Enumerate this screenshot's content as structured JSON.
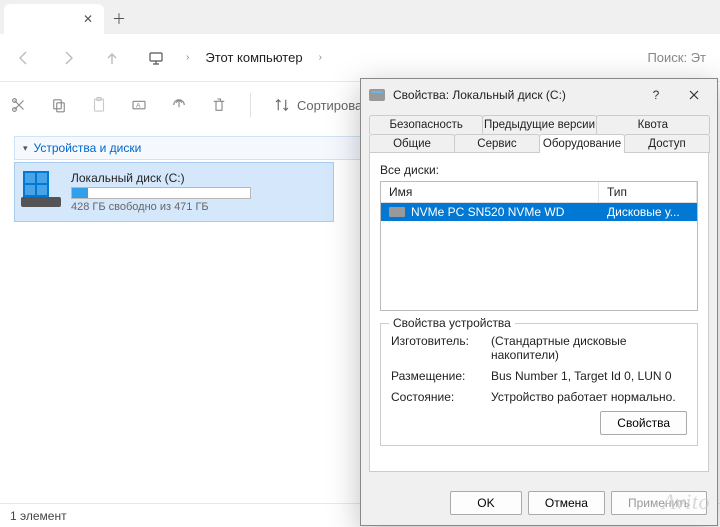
{
  "tabstrip": {
    "close_glyph": "✕",
    "newtab_glyph": "＋"
  },
  "addressbar": {
    "crumb": "Этот компьютер",
    "chevron": "›",
    "search_placeholder": "Поиск: Эт"
  },
  "toolbar": {
    "sort_label": "Сортировать"
  },
  "explorer": {
    "section_header": "Устройства и диски",
    "drive": {
      "name": "Локальный диск (C:)",
      "sub": "428 ГБ свободно из 471 ГБ",
      "fill_percent": 9
    }
  },
  "statusbar": {
    "text": "1 элемент"
  },
  "dialog": {
    "title": "Свойства: Локальный диск (C:)",
    "tabs_row1": [
      "Безопасность",
      "Предыдущие версии",
      "Квота"
    ],
    "tabs_row2": [
      "Общие",
      "Сервис",
      "Оборудование",
      "Доступ"
    ],
    "active_tab_index_row2": 2,
    "list_label": "Все диски:",
    "list_columns": [
      "Имя",
      "Тип"
    ],
    "list_items": [
      {
        "name": "NVMe PC SN520 NVMe WD",
        "type": "Дисковые у..."
      }
    ],
    "group": {
      "legend": "Свойства устройства",
      "rows": [
        {
          "k": "Изготовитель:",
          "v": "(Стандартные дисковые накопители)"
        },
        {
          "k": "Размещение:",
          "v": "Bus Number 1, Target Id 0, LUN 0"
        },
        {
          "k": "Состояние:",
          "v": "Устройство работает нормально."
        }
      ],
      "properties_btn": "Свойства"
    },
    "buttons": {
      "ok": "OK",
      "cancel": "Отмена",
      "apply": "Применить"
    }
  },
  "watermark": "Avito"
}
